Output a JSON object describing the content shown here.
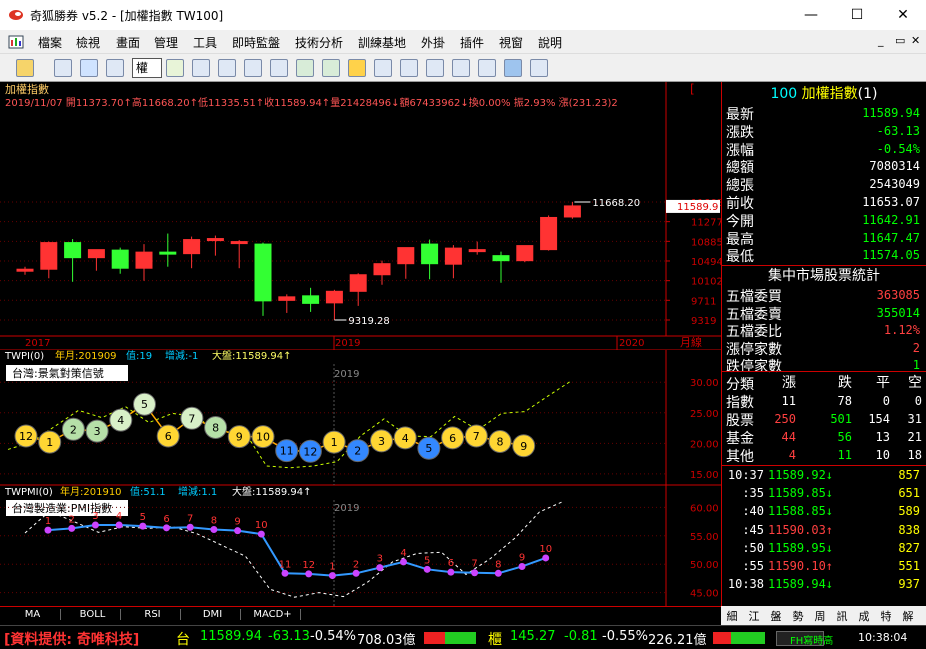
{
  "window": {
    "title": "奇狐勝券 v5.2 - [加權指數 TW100]",
    "min": "—",
    "max": "☐",
    "close": "✕"
  },
  "menu": [
    "檔案",
    "檢視",
    "畫面",
    "管理",
    "工具",
    "即時監盤",
    "技術分析",
    "訓練基地",
    "外掛",
    "插件",
    "視窗",
    "說明"
  ],
  "mdi": {
    "min": "_",
    "restore": "▭",
    "close": "✕"
  },
  "toolbar": {
    "combo": "權"
  },
  "kchart": {
    "title": "加權指數",
    "info": "2019/11/07 開11373.70↑高11668.20↑低11335.51↑收11589.94↑量21428496↓額67433962↓換0.00% 振2.93% 漲(231.23)2",
    "prices": [
      "11668",
      "11277",
      "10885",
      "10494",
      "10102",
      "9711",
      "9319"
    ],
    "current": "11589.9",
    "high_label": "11668.20",
    "low_label": "9319.28",
    "xlabels": [
      "2017",
      "2019",
      "2020"
    ],
    "xunit": "月線",
    "top_mark": "[",
    "candles": [
      {
        "o": 10300,
        "h": 10380,
        "l": 10220,
        "c": 10330
      },
      {
        "o": 10330,
        "h": 10880,
        "l": 10150,
        "c": 10860
      },
      {
        "o": 10860,
        "h": 10930,
        "l": 10080,
        "c": 10560
      },
      {
        "o": 10560,
        "h": 10720,
        "l": 10300,
        "c": 10720
      },
      {
        "o": 10710,
        "h": 10760,
        "l": 10240,
        "c": 10350
      },
      {
        "o": 10350,
        "h": 10830,
        "l": 10100,
        "c": 10670
      },
      {
        "o": 10670,
        "h": 11040,
        "l": 10380,
        "c": 10640
      },
      {
        "o": 10640,
        "h": 10980,
        "l": 10350,
        "c": 10920
      },
      {
        "o": 10920,
        "h": 11000,
        "l": 10600,
        "c": 10940
      },
      {
        "o": 10870,
        "h": 10910,
        "l": 10350,
        "c": 10880
      },
      {
        "o": 10830,
        "h": 10860,
        "l": 9400,
        "c": 9700
      },
      {
        "o": 9710,
        "h": 9830,
        "l": 9460,
        "c": 9780
      },
      {
        "o": 9800,
        "h": 9960,
        "l": 9480,
        "c": 9650
      },
      {
        "o": 9660,
        "h": 9920,
        "l": 9319,
        "c": 9890
      },
      {
        "o": 9890,
        "h": 10250,
        "l": 9600,
        "c": 10220
      },
      {
        "o": 10220,
        "h": 10500,
        "l": 10020,
        "c": 10440
      },
      {
        "o": 10440,
        "h": 10760,
        "l": 10140,
        "c": 10760
      },
      {
        "o": 10830,
        "h": 10920,
        "l": 10130,
        "c": 10440
      },
      {
        "o": 10430,
        "h": 10810,
        "l": 10150,
        "c": 10750
      },
      {
        "o": 10720,
        "h": 10880,
        "l": 10620,
        "c": 10720
      },
      {
        "o": 10600,
        "h": 10680,
        "l": 10060,
        "c": 10500
      },
      {
        "o": 10500,
        "h": 10800,
        "l": 10470,
        "c": 10800
      },
      {
        "o": 10720,
        "h": 11400,
        "l": 10700,
        "c": 11360
      },
      {
        "o": 11370,
        "h": 11668,
        "l": 11335,
        "c": 11590
      }
    ]
  },
  "twpi": {
    "header": {
      "code": "TWPI(0)",
      "ym": "年月:201909",
      "val": "值:19",
      "chg": "增減:-1",
      "idx": "大盤:11589.94↑"
    },
    "label": "台灣:景氣對策信號",
    "year": "2019",
    "ticks": [
      "30.00",
      "25.00",
      "20.00",
      "15.00"
    ],
    "balls": [
      12,
      1,
      2,
      3,
      4,
      5,
      6,
      7,
      8,
      9,
      10,
      11,
      12,
      1,
      2,
      3,
      4,
      5,
      6,
      7,
      8,
      9
    ],
    "ballvals": [
      21.2,
      20.2,
      22.3,
      22.0,
      23.8,
      26.4,
      21.2,
      24.1,
      22.6,
      21.1,
      21.1,
      18.8,
      18.7,
      20.2,
      18.8,
      20.4,
      20.9,
      19.2,
      20.9,
      21.2,
      20.3,
      19.6
    ],
    "dash": [
      19,
      20.2,
      22.8,
      25.4,
      24.2,
      26.0,
      23.4,
      24.9,
      24.4,
      21.6,
      22.3,
      16.3,
      16.0,
      16.3,
      17.0,
      21.2,
      24.0,
      21.2,
      21.1,
      24.4,
      22.2,
      24.9,
      25.2,
      27.8,
      30.3
    ]
  },
  "twpmi": {
    "header": {
      "code": "TWPMI(0)",
      "ym": "年月:201910",
      "val": "值:51.1",
      "chg": "增減:1.1",
      "idx": "大盤:11589.94↑"
    },
    "label": "台灣製造業:PMI指數",
    "year": "2019",
    "ticks": [
      "60.00",
      "55.00",
      "50.00",
      "45.00"
    ],
    "months": [
      1,
      2,
      3,
      4,
      5,
      6,
      7,
      8,
      9,
      10,
      11,
      12,
      1,
      2,
      3,
      4,
      5,
      6,
      7,
      8,
      9,
      10
    ],
    "vals": [
      56.0,
      56.3,
      56.9,
      56.9,
      56.7,
      56.4,
      56.5,
      56.1,
      55.9,
      55.3,
      48.4,
      48.3,
      48.0,
      48.4,
      49.4,
      50.4,
      49.1,
      48.6,
      48.5,
      48.4,
      49.6,
      51.1
    ],
    "dash": [
      55.5,
      59.3,
      57.5,
      55.6,
      56.6,
      56.3,
      56.6,
      55.4,
      53.4,
      51.4,
      45.6,
      44.2,
      45.0,
      44.3,
      46.9,
      50.4,
      51.9,
      52.1,
      48.2,
      51.0,
      54.6,
      59.2,
      61.1
    ]
  },
  "quote": {
    "title_code": "100",
    "title_name": "加權指數",
    "title_num": "(1)",
    "rows": [
      {
        "k": "最新",
        "v": "11589.94",
        "c": "#00ff00"
      },
      {
        "k": "漲跌",
        "v": "-63.13",
        "c": "#00ff00"
      },
      {
        "k": "漲幅",
        "v": "-0.54%",
        "c": "#00ff00"
      },
      {
        "k": "總額",
        "v": "7080314",
        "c": "#ffffff"
      },
      {
        "k": "總張",
        "v": "2543049",
        "c": "#ffffff"
      },
      {
        "k": "前收",
        "v": "11653.07",
        "c": "#ffffff"
      },
      {
        "k": "今開",
        "v": "11642.91",
        "c": "#00ff00"
      },
      {
        "k": "最高",
        "v": "11647.47",
        "c": "#00ff00"
      },
      {
        "k": "最低",
        "v": "11574.05",
        "c": "#00ff00"
      }
    ],
    "stat_title": "集中市場股票統計",
    "stats": [
      {
        "k": "五檔委買",
        "v": "363085",
        "c": "#ff4040"
      },
      {
        "k": "五檔委賣",
        "v": "355014",
        "c": "#00ff00"
      },
      {
        "k": "五檔委比",
        "v": "1.12%",
        "c": "#ff4040"
      },
      {
        "k": "漲停家數",
        "v": "2",
        "c": "#ff4040"
      },
      {
        "k": "跌停家數",
        "v": "1",
        "c": "#00ff00"
      }
    ],
    "tbl_head": [
      "分類",
      "漲",
      "跌",
      "平",
      "空"
    ],
    "tbl": [
      {
        "k": "指數",
        "v": [
          "11",
          "78",
          "0",
          "0"
        ],
        "c": [
          "#fff",
          "#fff",
          "#fff",
          "#fff"
        ]
      },
      {
        "k": "股票",
        "v": [
          "250",
          "501",
          "154",
          "31"
        ],
        "c": [
          "#ff4040",
          "#00ff00",
          "#fff",
          "#fff"
        ]
      },
      {
        "k": "基金",
        "v": [
          "44",
          "56",
          "13",
          "21"
        ],
        "c": [
          "#ff4040",
          "#00ff00",
          "#fff",
          "#fff"
        ]
      },
      {
        "k": "其他",
        "v": [
          "4",
          "11",
          "10",
          "18"
        ],
        "c": [
          "#ff4040",
          "#00ff00",
          "#fff",
          "#fff"
        ]
      }
    ],
    "ticks": [
      {
        "t": "10:37",
        "p": "11589.92↓",
        "v": "857"
      },
      {
        "t": ":35",
        "p": "11589.85↓",
        "v": "651"
      },
      {
        "t": ":40",
        "p": "11588.85↓",
        "v": "589"
      },
      {
        "t": ":45",
        "p": "11590.03↑",
        "v": "838"
      },
      {
        "t": ":50",
        "p": "11589.95↓",
        "v": "827"
      },
      {
        "t": ":55",
        "p": "11590.10↑",
        "v": "551"
      },
      {
        "t": "10:38",
        "p": "11589.94↓",
        "v": "937"
      }
    ]
  },
  "bottom_tabs": [
    "MA",
    "BOLL",
    "RSI",
    "DMI",
    "MACD+"
  ],
  "right_tabs": [
    "細",
    "江",
    "盤",
    "勢",
    "周",
    "訊",
    "成",
    "特",
    "解"
  ],
  "status": {
    "source": "[資料提供: 奇唯科技]",
    "tw_label": "台",
    "tw_idx": "11589.94",
    "tw_chg": "-63.13",
    "tw_pct": "-0.54%",
    "tw_amt": "708.03億",
    "otc_label": "櫃",
    "otc_idx": "145.27",
    "otc_chg": "-0.81",
    "otc_pct": "-0.55%",
    "otc_amt": "226.21億",
    "fh": "FH寫時高",
    "time": "10:38:04"
  }
}
